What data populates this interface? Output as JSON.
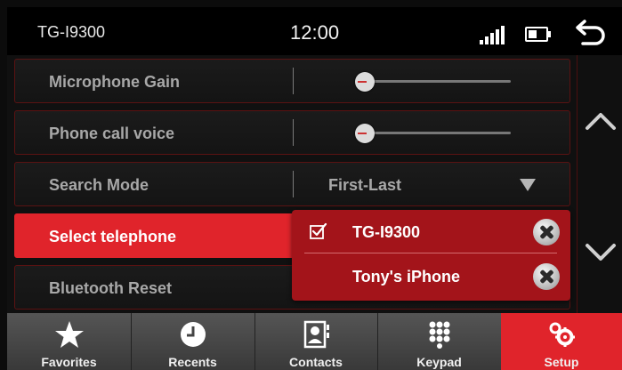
{
  "status": {
    "device_name": "TG-I9300",
    "time": "12:00",
    "signal_bars": 5,
    "battery_level": 0.5
  },
  "settings": [
    {
      "label": "Microphone Gain",
      "type": "slider",
      "value": 0.05
    },
    {
      "label": "Phone call voice",
      "type": "slider",
      "value": 0.05
    },
    {
      "label": "Search Mode",
      "type": "dropdown",
      "value": "First-Last"
    },
    {
      "label": "Select telephone",
      "type": "selector",
      "active": true
    },
    {
      "label": "Bluetooth Reset",
      "type": "action"
    }
  ],
  "popup": {
    "phones": [
      {
        "name": "TG-I9300",
        "selected": true
      },
      {
        "name": "Tony's iPhone",
        "selected": false
      }
    ]
  },
  "nav": [
    {
      "label": "Favorites",
      "icon": "star-icon"
    },
    {
      "label": "Recents",
      "icon": "clock-icon"
    },
    {
      "label": "Contacts",
      "icon": "contact-book-icon"
    },
    {
      "label": "Keypad",
      "icon": "keypad-icon"
    },
    {
      "label": "Setup",
      "icon": "gears-icon",
      "active": true
    }
  ],
  "colors": {
    "accent": "#e0242b",
    "popup": "#a3141a",
    "row_border": "#5a1212",
    "background": "#101010"
  }
}
